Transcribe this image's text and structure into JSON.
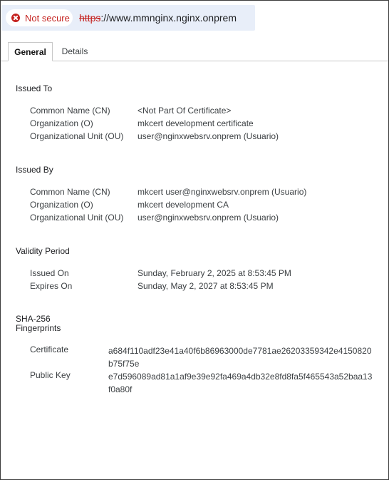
{
  "addressbar": {
    "security_label": "Not secure",
    "url_scheme": "https",
    "url_rest": "://www.mmnginx.nginx.onprem"
  },
  "tabs": [
    {
      "label": "General",
      "active": true
    },
    {
      "label": "Details",
      "active": false
    }
  ],
  "issued_to": {
    "title": "Issued To",
    "fields": [
      {
        "label": "Common Name (CN)",
        "value": "<Not Part Of Certificate>"
      },
      {
        "label": "Organization (O)",
        "value": "mkcert development certificate"
      },
      {
        "label": "Organizational Unit (OU)",
        "value": "user@nginxwebsrv.onprem (Usuario)"
      }
    ]
  },
  "issued_by": {
    "title": "Issued By",
    "fields": [
      {
        "label": "Common Name (CN)",
        "value": "mkcert user@nginxwebsrv.onprem (Usuario)"
      },
      {
        "label": "Organization (O)",
        "value": "mkcert development CA"
      },
      {
        "label": "Organizational Unit (OU)",
        "value": "user@nginxwebsrv.onprem (Usuario)"
      }
    ]
  },
  "validity": {
    "title": "Validity Period",
    "fields": [
      {
        "label": "Issued On",
        "value": "Sunday, February 2, 2025 at 8:53:45 PM"
      },
      {
        "label": "Expires On",
        "value": "Sunday, May 2, 2027 at 8:53:45 PM"
      }
    ]
  },
  "fingerprints": {
    "title_line1": "SHA-256",
    "title_line2": "Fingerprints",
    "fields": [
      {
        "label": "Certificate",
        "value": "a684f110adf23e41a40f6b86963000de7781ae26203359342e4150820b75f75e"
      },
      {
        "label": "Public Key",
        "value": "e7d596089ad81a1af9e39e92fa469a4db32e8fd8fa5f465543a52baa13f0a80f"
      }
    ]
  },
  "colors": {
    "warning": "#c5221f",
    "urlbar_bg": "#e8eef9"
  },
  "icons": {
    "security": "not-secure-warning-icon"
  }
}
